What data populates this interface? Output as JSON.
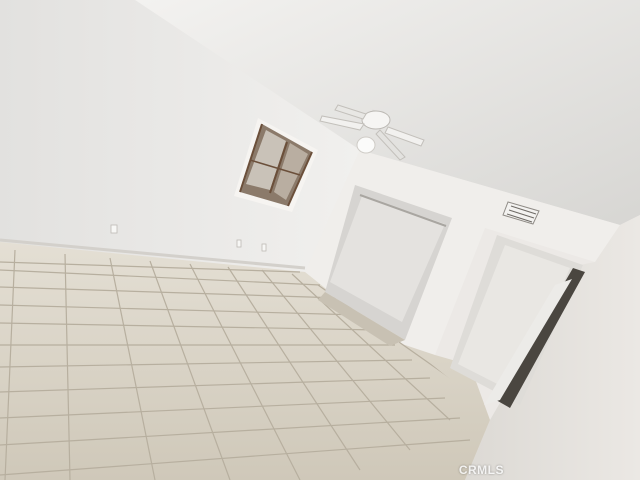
{
  "photo": {
    "subject": "empty-room-interior",
    "colors": {
      "ceiling": "#e7e6e4",
      "left_wall": "#e9e8e6",
      "back_wall": "#f1efec",
      "right_wall": "#e6e3df",
      "tile": "#d9d3c6",
      "grout": "#b8b0a0",
      "window_frame": "#7a5a45"
    },
    "fixtures": [
      "ceiling-fan",
      "window",
      "closet",
      "doorway",
      "air-vent"
    ]
  },
  "watermark": {
    "text": "CRMLS"
  }
}
